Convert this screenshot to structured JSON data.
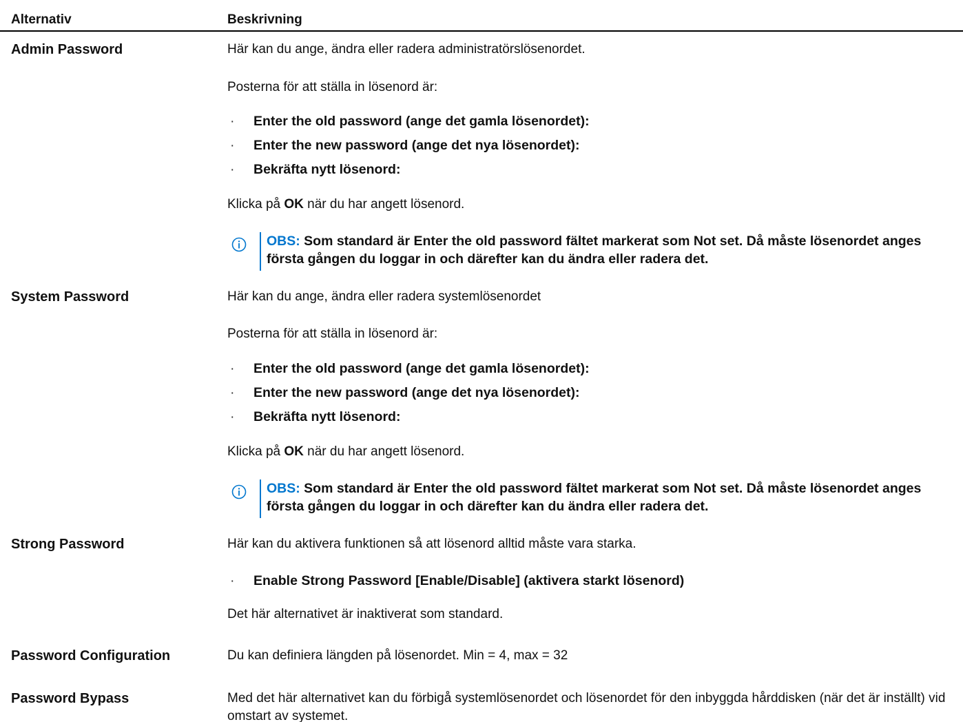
{
  "table": {
    "headers": [
      "Alternativ",
      "Beskrivning"
    ]
  },
  "rows": {
    "admin": {
      "option": "Admin Password",
      "desc1": "Här kan du ange, ändra eller radera administratörslösenordet.",
      "desc2": "Posterna för att ställa in lösenord är:",
      "bullets": [
        "Enter the old password (ange det gamla lösenordet):",
        "Enter the new password (ange det nya lösenordet):",
        "Bekräfta nytt lösenord:"
      ],
      "click_pre": "Klicka på ",
      "click_ok": "OK",
      "click_post": " när du har angett lösenord.",
      "note_label": "OBS:",
      "note_text": " Som standard är Enter the old password fältet markerat som Not set. Då måste lösenordet anges första gången du loggar in och därefter kan du ändra eller radera det."
    },
    "system": {
      "option": "System Password",
      "desc1": "Här kan du ange, ändra eller radera systemlösenordet",
      "desc2": "Posterna för att ställa in lösenord är:",
      "bullets": [
        "Enter the old password (ange det gamla lösenordet):",
        "Enter the new password (ange det nya lösenordet):",
        "Bekräfta nytt lösenord:"
      ],
      "click_pre": "Klicka på ",
      "click_ok": "OK",
      "click_post": " när du har angett lösenord.",
      "note_label": "OBS:",
      "note_text": " Som standard är Enter the old password fältet markerat som Not set. Då måste lösenordet anges första gången du loggar in och därefter kan du ändra eller radera det."
    },
    "strong": {
      "option": "Strong Password",
      "desc1": "Här kan du aktivera funktionen så att lösenord alltid måste vara starka.",
      "bullets": [
        "Enable Strong Password [Enable/Disable] (aktivera starkt lösenord)"
      ],
      "desc2": "Det här alternativet är inaktiverat som standard."
    },
    "config": {
      "option": "Password Configuration",
      "desc1": "Du kan definiera längden på lösenordet. Min = 4, max = 32"
    },
    "bypass": {
      "option": "Password Bypass",
      "desc1": "Med det här alternativet kan du förbigå systemlösenordet och lösenordet för den inbyggda hårddisken (när det är inställt) vid omstart av systemet."
    }
  },
  "icons": {
    "note": "info-circle-icon",
    "bullet": "middle-dot"
  },
  "colors": {
    "accent": "#0076ce",
    "text": "#111111"
  }
}
